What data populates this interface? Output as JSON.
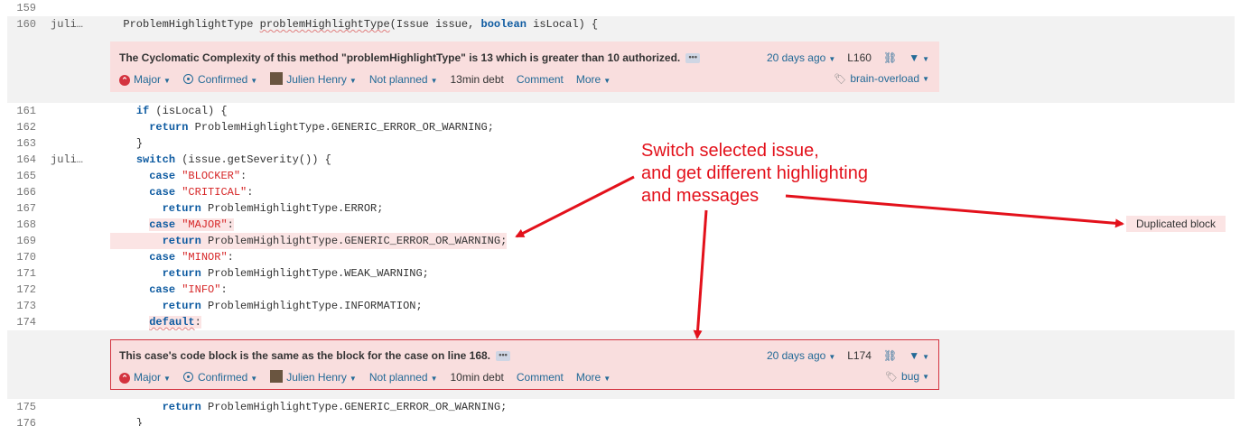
{
  "lines": [
    {
      "num": "159",
      "author": ""
    },
    {
      "num": "160",
      "author": "juli…"
    },
    {
      "num": "161",
      "author": ""
    },
    {
      "num": "162",
      "author": ""
    },
    {
      "num": "163",
      "author": ""
    },
    {
      "num": "164",
      "author": "juli…"
    },
    {
      "num": "165",
      "author": ""
    },
    {
      "num": "166",
      "author": ""
    },
    {
      "num": "167",
      "author": ""
    },
    {
      "num": "168",
      "author": ""
    },
    {
      "num": "169",
      "author": ""
    },
    {
      "num": "170",
      "author": ""
    },
    {
      "num": "171",
      "author": ""
    },
    {
      "num": "172",
      "author": ""
    },
    {
      "num": "173",
      "author": ""
    },
    {
      "num": "174",
      "author": ""
    },
    {
      "num": "175",
      "author": ""
    },
    {
      "num": "176",
      "author": ""
    }
  ],
  "code": {
    "l160_a": "  ProblemHighlightType ",
    "l160_method": "problemHighlightType",
    "l160_b": "(Issue issue, ",
    "l160_kw": "boolean",
    "l160_c": " isLocal) {",
    "kw_if": "if",
    "l161_rest": " (isLocal) {",
    "kw_return": "return",
    "l162_rest": " ProblemHighlightType.GENERIC_ERROR_OR_WARNING;",
    "l163": "}",
    "kw_switch": "switch",
    "l164_rest": " (issue.getSeverity()) {",
    "kw_case": "case",
    "s_blocker": "\"BLOCKER\"",
    "s_critical": "\"CRITICAL\"",
    "colon": ":",
    "l167_rest": " ProblemHighlightType.ERROR;",
    "s_major": "\"MAJOR\"",
    "l169_rest": " ProblemHighlightType.GENERIC_ERROR_OR_WARNING;",
    "s_minor": "\"MINOR\"",
    "l171_rest": " ProblemHighlightType.WEAK_WARNING;",
    "s_info": "\"INFO\"",
    "l173_rest": " ProblemHighlightType.INFORMATION;",
    "kw_default": "default",
    "l175_rest": " ProblemHighlightType.GENERIC_ERROR_OR_WARNING;",
    "l176": "}"
  },
  "issue1": {
    "message": "The Cyclomatic Complexity of this method \"problemHighlightType\" is 13 which is greater than 10 authorized.",
    "age": "20 days ago",
    "line_ref": "L160",
    "severity": "Major",
    "status": "Confirmed",
    "assignee": "Julien Henry",
    "plan": "Not planned",
    "debt": "13min debt",
    "comment": "Comment",
    "more": "More",
    "tag": "brain-overload"
  },
  "issue2": {
    "message": "This case's code block is the same as the block for the case on line 168.",
    "age": "20 days ago",
    "line_ref": "L174",
    "severity": "Major",
    "status": "Confirmed",
    "assignee": "Julien Henry",
    "plan": "Not planned",
    "debt": "10min debt",
    "comment": "Comment",
    "more": "More",
    "tag": "bug"
  },
  "annotation": {
    "line1": "Switch selected issue,",
    "line2": "and get different highlighting",
    "line3": "and messages"
  },
  "duplicated_label": "Duplicated block",
  "colors": {
    "accent": "#e3111b",
    "issue_bg": "#f9dede",
    "link": "#236a97",
    "keyword": "#0e5ba1",
    "string": "#d62728"
  }
}
